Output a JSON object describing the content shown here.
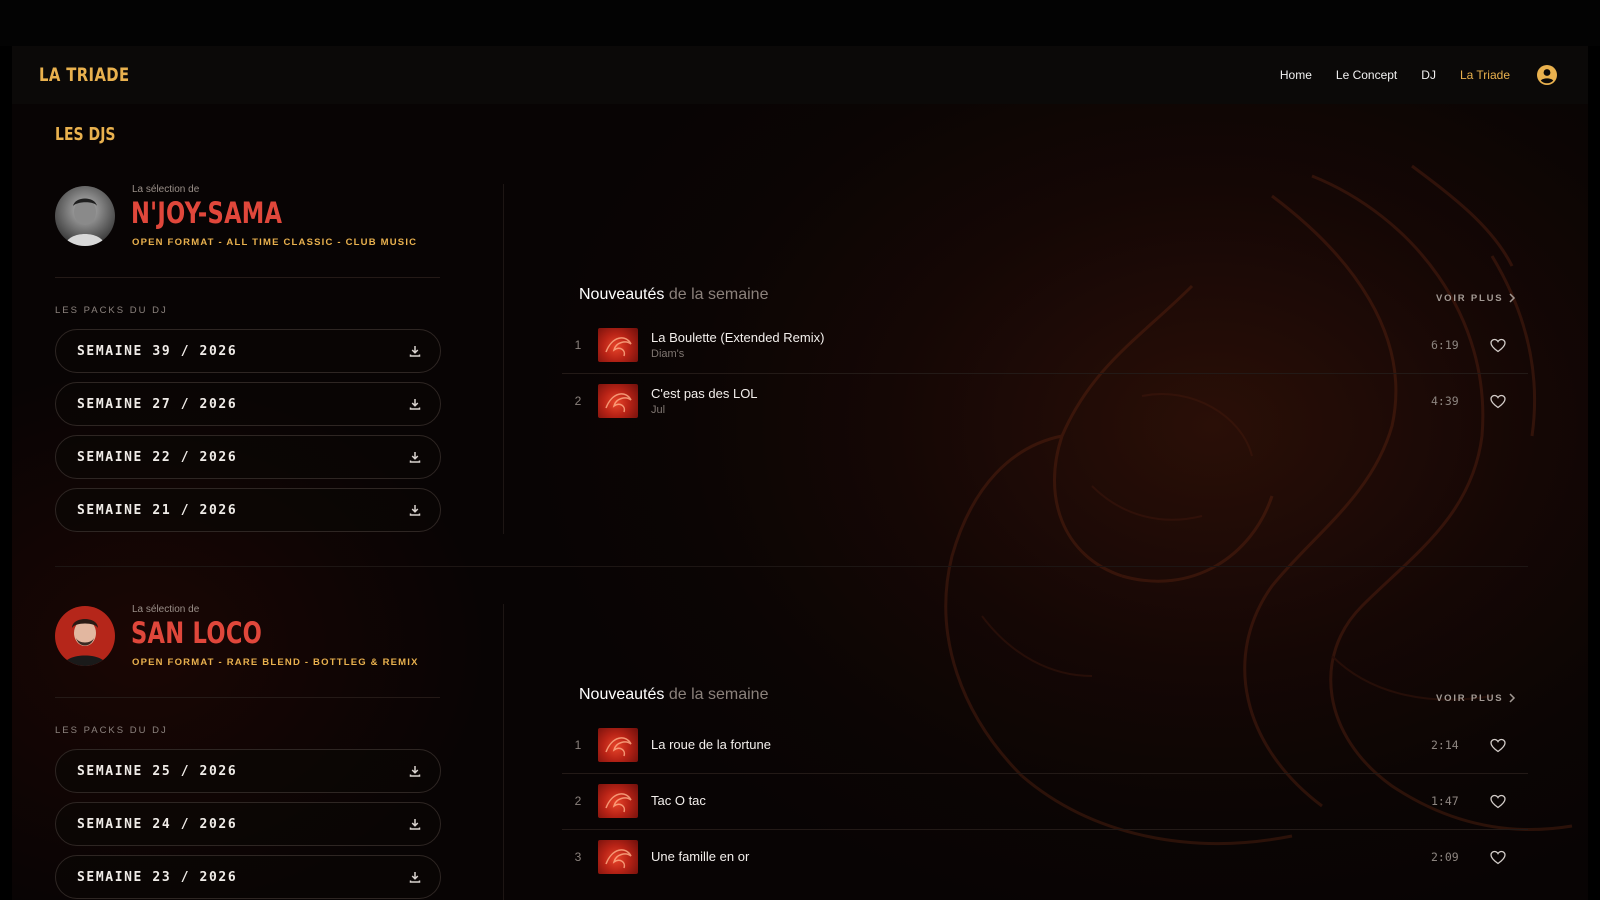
{
  "header": {
    "logo": "LA TRIADE",
    "nav": [
      "Home",
      "Le Concept",
      "DJ",
      "La Triade"
    ],
    "active_nav": "La Triade",
    "user_icon": "user-circle-icon"
  },
  "section_title": "LES DJS",
  "colors": {
    "accent_gold": "#e9b14e",
    "dj_name_red": "#e0473b",
    "background": "#0b0504"
  },
  "djs": [
    {
      "selection_label": "La sélection de",
      "name": "N'JOY-SAMA",
      "tags": "OPEN FORMAT - ALL TIME CLASSIC - CLUB MUSIC",
      "packs_label": "LES PACKS DU DJ",
      "packs": [
        "SEMAINE 39 / 2026",
        "SEMAINE 27 / 2026",
        "SEMAINE 22 / 2026",
        "SEMAINE 21 / 2026"
      ],
      "news": {
        "title_strong": "Nouveautés",
        "title_light": "de la semaine",
        "voir_plus": "VOIR PLUS",
        "tracks": [
          {
            "num": "1",
            "title": "La Boulette (Extended Remix)",
            "artist": "Diam's",
            "duration": "6:19"
          },
          {
            "num": "2",
            "title": "C'est pas des LOL",
            "artist": "Jul",
            "duration": "4:39"
          }
        ]
      }
    },
    {
      "selection_label": "La sélection de",
      "name": "SAN LOCO",
      "tags": "OPEN FORMAT - RARE BLEND - BOTTLEG & REMIX",
      "packs_label": "LES PACKS DU DJ",
      "packs": [
        "SEMAINE 25 / 2026",
        "SEMAINE 24 / 2026",
        "SEMAINE 23 / 2026"
      ],
      "news": {
        "title_strong": "Nouveautés",
        "title_light": "de la semaine",
        "voir_plus": "VOIR PLUS",
        "tracks": [
          {
            "num": "1",
            "title": "La roue de la fortune",
            "artist": "",
            "duration": "2:14"
          },
          {
            "num": "2",
            "title": "Tac O tac",
            "artist": "",
            "duration": "1:47"
          },
          {
            "num": "3",
            "title": "Une famille en or",
            "artist": "",
            "duration": "2:09"
          }
        ]
      }
    }
  ]
}
